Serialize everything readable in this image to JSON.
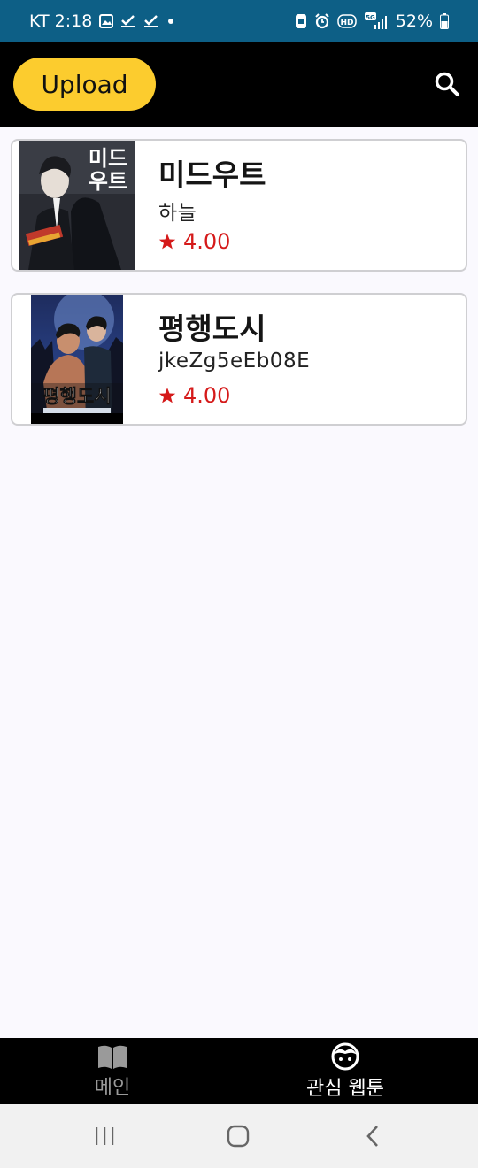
{
  "status_bar": {
    "carrier_time": "KT 2:18",
    "battery": "52%",
    "bg_color": "#0d5f86"
  },
  "app_bar": {
    "upload_label": "Upload",
    "upload_color": "#fccc2e",
    "search_icon": "search-icon"
  },
  "webtoons": [
    {
      "title": "미드우트",
      "author": "하늘",
      "rating": "4.00",
      "cover_text": "미드\n우트"
    },
    {
      "title": "평행도시",
      "author": "jkeZg5eEb08E",
      "rating": "4.00",
      "cover_text": "평행도시"
    }
  ],
  "bottom_nav": {
    "items": [
      {
        "label": "메인",
        "icon": "book-icon",
        "active": false
      },
      {
        "label": "관심 웹툰",
        "icon": "face-icon",
        "active": true
      }
    ],
    "active_color": "#ffffff",
    "inactive_color": "#9a9a9a"
  },
  "system_nav": {
    "icons": [
      "recents-icon",
      "home-icon",
      "back-icon"
    ]
  },
  "colors": {
    "rating": "#d51a1a",
    "card_border": "#cfcfd2",
    "background": "#faf9fe"
  }
}
